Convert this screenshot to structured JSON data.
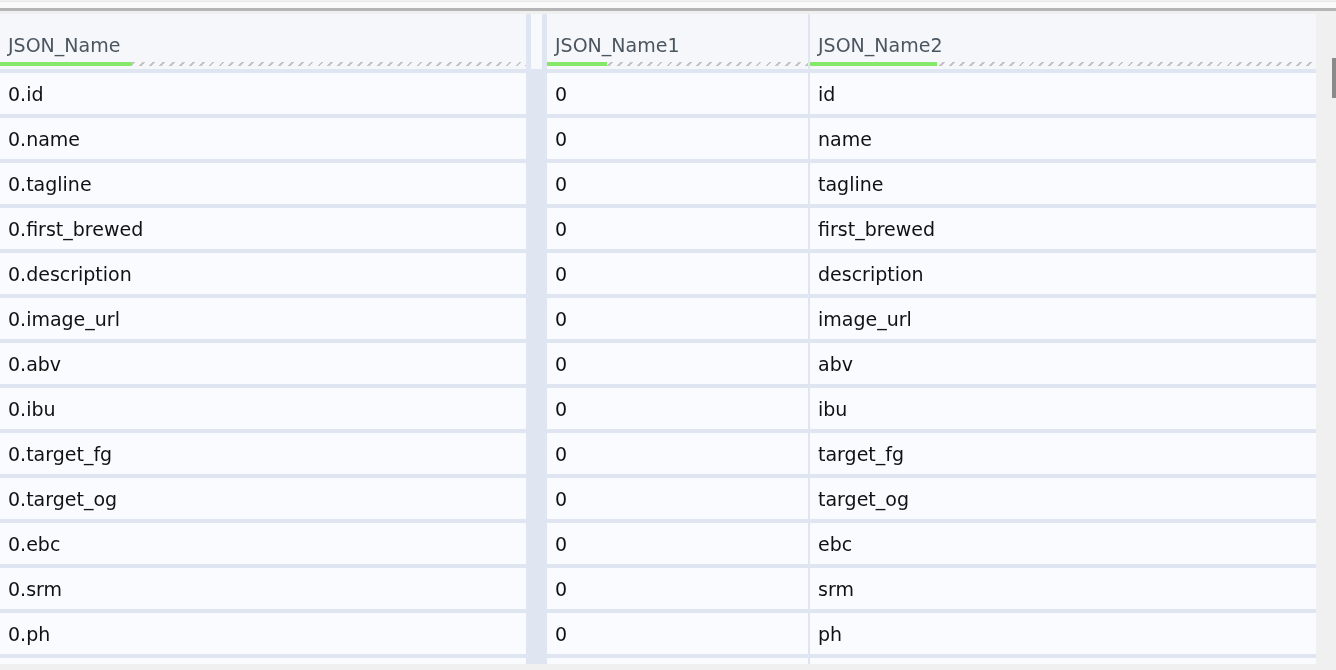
{
  "table": {
    "columns": [
      {
        "label": "JSON_Name",
        "level": 0.25
      },
      {
        "label": "JSON_Name1",
        "level": 0.23
      },
      {
        "label": "JSON_Name2",
        "level": 0.25
      }
    ],
    "rows": [
      [
        "0.id",
        "0",
        "id"
      ],
      [
        "0.name",
        "0",
        "name"
      ],
      [
        "0.tagline",
        "0",
        "tagline"
      ],
      [
        "0.first_brewed",
        "0",
        "first_brewed"
      ],
      [
        "0.description",
        "0",
        "description"
      ],
      [
        "0.image_url",
        "0",
        "image_url"
      ],
      [
        "0.abv",
        "0",
        "abv"
      ],
      [
        "0.ibu",
        "0",
        "ibu"
      ],
      [
        "0.target_fg",
        "0",
        "target_fg"
      ],
      [
        "0.target_og",
        "0",
        "target_og"
      ],
      [
        "0.ebc",
        "0",
        "ebc"
      ],
      [
        "0.srm",
        "0",
        "srm"
      ],
      [
        "0.ph",
        "0",
        "ph"
      ]
    ]
  }
}
